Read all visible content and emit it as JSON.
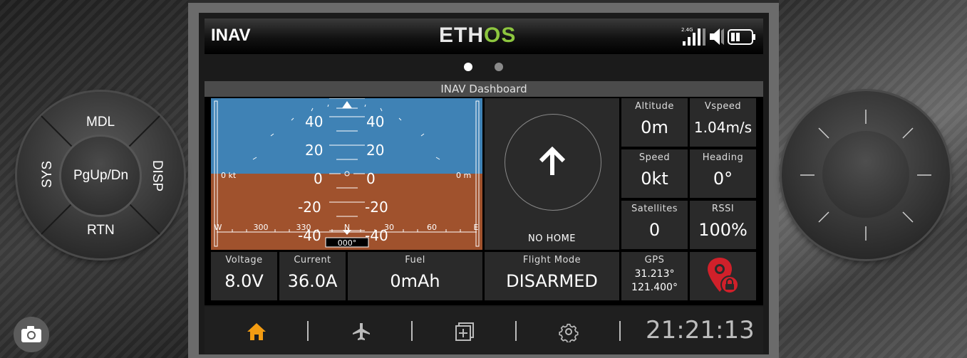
{
  "header": {
    "model_name": "INAV",
    "logo_part1": "ETH",
    "logo_part2": "OS",
    "rf_band": "2.4G"
  },
  "pager": {
    "pages": 2,
    "active": 1
  },
  "dashboard": {
    "title": "INAV Dashboard",
    "attitude": {
      "pitch_ladder": [
        "40",
        "20",
        "0",
        "-20",
        "-40"
      ],
      "speed_readout": "0 kt",
      "altitude_readout": "0 m",
      "heading_box": "000°",
      "compass_labels": [
        "W",
        "300",
        "330",
        "N",
        "30",
        "60",
        "E"
      ]
    },
    "home": {
      "status": "NO HOME"
    },
    "stats": [
      {
        "label": "Altitude",
        "value": "0m"
      },
      {
        "label": "Vspeed",
        "value": "1.04m/s"
      },
      {
        "label": "Speed",
        "value": "0kt"
      },
      {
        "label": "Heading",
        "value": "0°"
      },
      {
        "label": "Satellites",
        "value": "0"
      },
      {
        "label": "RSSI",
        "value": "100%"
      }
    ],
    "bottom": {
      "voltage": {
        "label": "Voltage",
        "value": "8.0V"
      },
      "current": {
        "label": "Current",
        "value": "36.0A"
      },
      "fuel": {
        "label": "Fuel",
        "value": "0mAh"
      },
      "flight_mode": {
        "label": "Flight Mode",
        "value": "DISARMED"
      },
      "gps": {
        "label": "GPS",
        "lat": "31.213°",
        "lon": "121.400°"
      }
    }
  },
  "navbar": {
    "clock": "21:21:13"
  },
  "left_dial": {
    "top": "MDL",
    "left": "SYS",
    "center": "PgUp/Dn",
    "right": "DISP",
    "bottom": "RTN"
  },
  "colors": {
    "sky": "#3f82b5",
    "ground": "#a0522d",
    "accent_orange": "#f39c12",
    "logo_green": "#8dc63f",
    "gps_red": "#d0202a"
  }
}
